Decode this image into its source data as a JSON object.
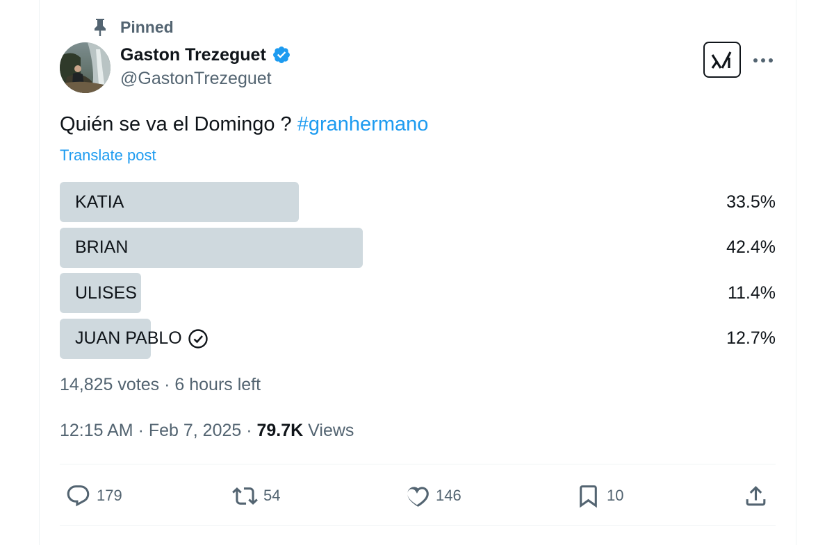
{
  "pinned": {
    "label": "Pinned",
    "icon": "pin-icon"
  },
  "author": {
    "name": "Gaston Trezeguet",
    "handle": "@GastonTrezeguet",
    "verified_color": "#1d9bf0"
  },
  "post": {
    "text": "Quién se va el Domingo ? ",
    "hashtag": "#granhermano",
    "translate_label": "Translate post"
  },
  "poll": {
    "options": [
      {
        "label": "KATIA",
        "percent_label": "33.5%",
        "percent": 33.5,
        "chosen": false
      },
      {
        "label": "BRIAN",
        "percent_label": "42.4%",
        "percent": 42.4,
        "chosen": false
      },
      {
        "label": "ULISES",
        "percent_label": "11.4%",
        "percent": 11.4,
        "chosen": false
      },
      {
        "label": "JUAN PABLO",
        "percent_label": "12.7%",
        "percent": 12.7,
        "chosen": true
      }
    ],
    "status": "14,825 votes · 6 hours left"
  },
  "meta": {
    "timestamp": "12:15 AM · Feb 7, 2025 · ",
    "views_count": "79.7K",
    "views_label": " Views"
  },
  "actions": {
    "replies": "179",
    "reposts": "54",
    "likes": "146",
    "bookmarks": "10"
  },
  "colors": {
    "accent": "#1d9bf0",
    "bar": "#cfd9de",
    "muted_text": "#536471",
    "text": "#0f1419"
  }
}
